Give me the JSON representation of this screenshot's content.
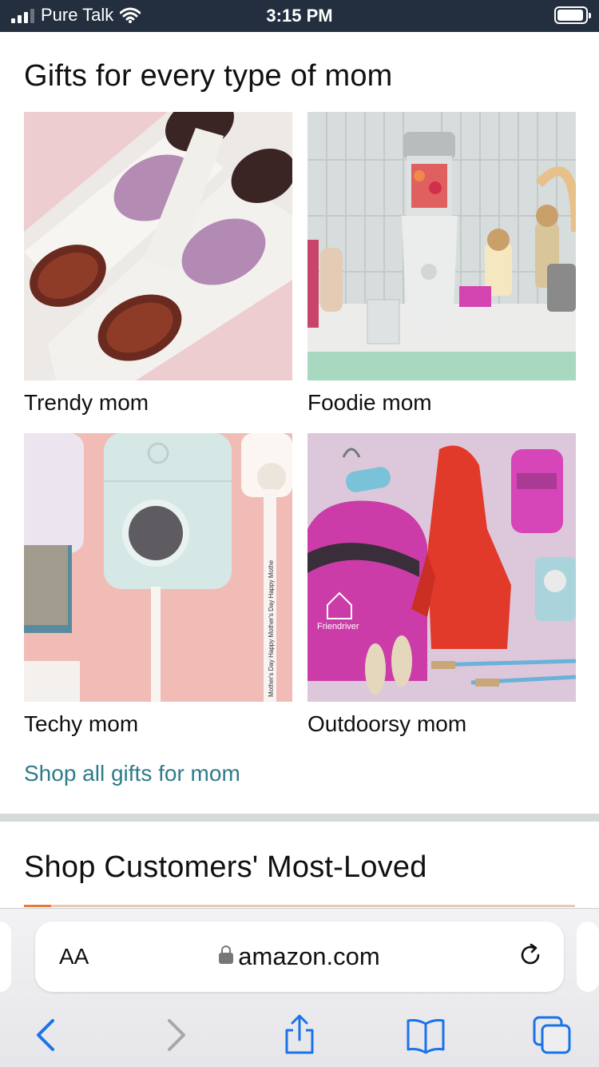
{
  "status": {
    "carrier": "Pure Talk",
    "time": "3:15 PM"
  },
  "gifts": {
    "title": "Gifts for every type of mom",
    "tiles": [
      {
        "label": "Trendy mom"
      },
      {
        "label": "Foodie mom"
      },
      {
        "label": "Techy mom"
      },
      {
        "label": "Outdoorsy mom",
        "brand_text": "Friendriver"
      }
    ],
    "shop_all": "Shop all gifts for mom"
  },
  "next_section": {
    "title": "Shop Customers' Most-Loved"
  },
  "browser": {
    "text_size_label": "AA",
    "url": "amazon.com"
  },
  "colors": {
    "link": "#2f7b89",
    "status_bar": "#232f3e",
    "ios_blue": "#1a73e8"
  }
}
